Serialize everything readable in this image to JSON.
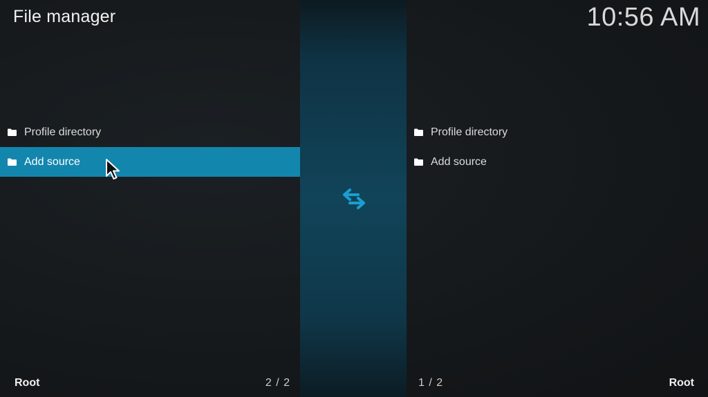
{
  "header": {
    "title": "File manager",
    "clock": "10:56 AM"
  },
  "left_pane": {
    "items": [
      {
        "label": "Profile directory",
        "icon": "folder-icon"
      },
      {
        "label": "Add source",
        "icon": "folder-icon",
        "selected": true
      }
    ],
    "footer_path": "Root",
    "footer_count": "2 / 2"
  },
  "right_pane": {
    "items": [
      {
        "label": "Profile directory",
        "icon": "folder-icon"
      },
      {
        "label": "Add source",
        "icon": "folder-icon"
      }
    ],
    "footer_path": "Root",
    "footer_count": "1 / 2"
  },
  "center": {
    "icon": "swap-arrows-icon"
  },
  "colors": {
    "accent": "#1386ad",
    "swap_icon": "#1a9fd0"
  }
}
